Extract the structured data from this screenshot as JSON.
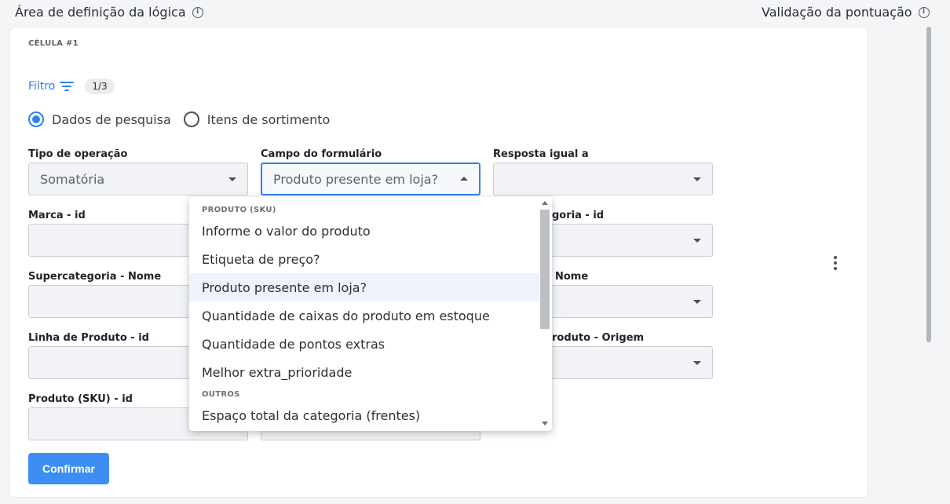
{
  "header": {
    "left_title": "Área de definição da lógica",
    "right_title": "Validação da pontuação",
    "info_glyph": "i"
  },
  "cell": {
    "title": "CÉLULA #1"
  },
  "filter": {
    "label": "Filtro",
    "badge": "1/3"
  },
  "radios": [
    {
      "label": "Dados de pesquisa",
      "checked": true
    },
    {
      "label": "Itens de sortimento",
      "checked": false
    }
  ],
  "fields": {
    "tipo_operacao": {
      "label": "Tipo de operação",
      "value": "Somatória"
    },
    "campo_formulario": {
      "label": "Campo do formulário",
      "value": "Produto presente em loja?"
    },
    "resposta_igual": {
      "label": "Resposta igual a",
      "value": ""
    },
    "marca_id": {
      "label": "Marca - id",
      "value": ""
    },
    "categoria_id": {
      "label": "goria - id",
      "value": ""
    },
    "supercategoria_nome": {
      "label": "Supercategoria - Nome",
      "value": ""
    },
    "col3_nome": {
      "label": "Nome",
      "value": ""
    },
    "linha_produto_id": {
      "label": "Linha de Produto - id",
      "value": ""
    },
    "produto_origem": {
      "label": "roduto - Origem",
      "value": ""
    },
    "produto_sku_id": {
      "label": "Produto (SKU) - id",
      "value": ""
    }
  },
  "dropdown": {
    "group1": "PRODUTO (SKU)",
    "items1": [
      "Informe o valor do produto",
      "Etiqueta de preço?",
      "Produto presente em loja?",
      "Quantidade de caixas do produto em estoque",
      "Quantidade de pontos extras",
      "Melhor extra_prioridade"
    ],
    "highlighted_index": 2,
    "group2": "OUTROS",
    "items2": [
      "Espaço total da categoria (frentes)"
    ]
  },
  "buttons": {
    "confirm": "Confirmar"
  },
  "colors": {
    "accent": "#2f80ed",
    "button": "#3d8ef2"
  }
}
